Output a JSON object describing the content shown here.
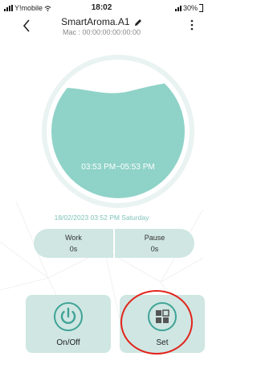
{
  "status_bar": {
    "carrier": "Y!mobile",
    "time": "18:02",
    "battery": "30%"
  },
  "header": {
    "title": "SmartAroma.A1",
    "mac": "Mac : 00:00:00:00:00:00",
    "back_icon": "chevron-left-icon",
    "edit_icon": "pencil-icon",
    "more_icon": "more-vertical-icon"
  },
  "tank": {
    "time_range": "03:53 PM~05:53 PM",
    "fill_color": "#8fd2c8",
    "ring_color": "#e9f3f1"
  },
  "datetime": "18/02/2023 03:52 PM Saturday",
  "stats": {
    "work_label": "Work",
    "work_value": "0s",
    "pause_label": "Pause",
    "pause_value": "0s"
  },
  "buttons": {
    "onoff_label": "On/Off",
    "set_label": "Set"
  },
  "colors": {
    "accent": "#3fa396",
    "panel": "#cfe6e2",
    "highlight": "#e2231a"
  }
}
